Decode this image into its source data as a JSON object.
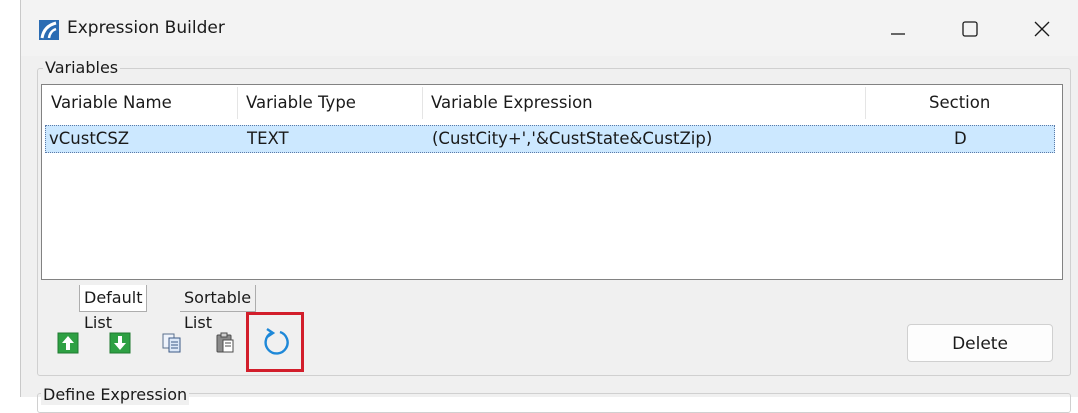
{
  "window": {
    "title": "Expression Builder",
    "controls": {
      "minimize": "minimize-icon",
      "maximize": "maximize-icon",
      "close": "close-icon"
    }
  },
  "variables_group": {
    "label": "Variables",
    "columns": [
      "Variable Name",
      "Variable Type",
      "Variable Expression",
      "Section"
    ],
    "rows": [
      {
        "name": "vCustCSZ",
        "type": "TEXT",
        "expression": "(CustCity+','&CustState&CustZip)",
        "section": "D"
      }
    ],
    "tabs": [
      "Default List",
      "Sortable List"
    ],
    "toolbar": {
      "icons": [
        "move-up-icon",
        "move-down-icon",
        "copy-icon",
        "paste-icon",
        "refresh-icon"
      ],
      "delete_label": "Delete"
    },
    "highlight_color": "#d21e2b"
  },
  "define_group": {
    "label": "Define Expression"
  }
}
